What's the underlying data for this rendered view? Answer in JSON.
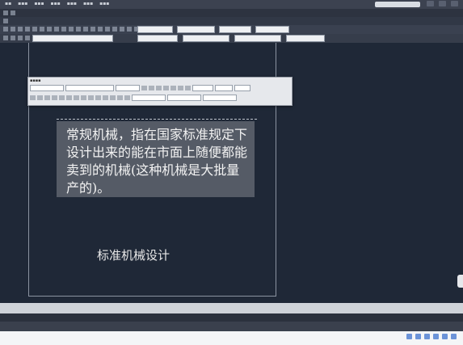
{
  "app": {
    "title": ""
  },
  "text_editor": {
    "paragraph": "常规机械，指在国家标准规定下设计出来的能在市面上随便都能卖到的机械(这种机械是大批量产的)。"
  },
  "drawing": {
    "caption": "标准机械设计"
  },
  "footer": {
    "watermark": ""
  },
  "colors": {
    "background": "#1f2837",
    "paper_border": "#8b93a1",
    "edit_box": "#555b66",
    "watermark": "#d21f1f"
  }
}
